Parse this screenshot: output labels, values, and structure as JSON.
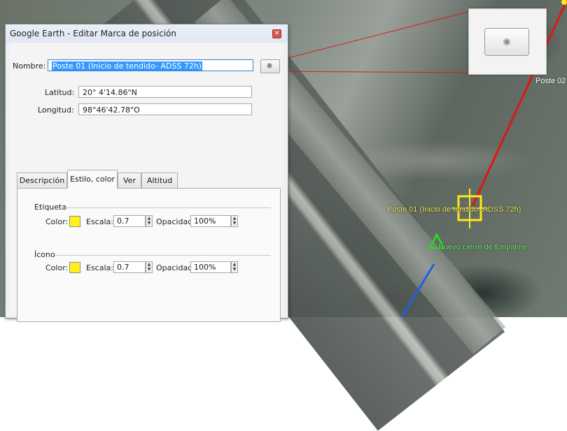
{
  "map": {
    "labels": {
      "pole2": "Poste 02",
      "pole1": "Poste 01  (Inicio de tendido- ADSS 72h)",
      "splice": "Nuevo cierre de Empalme"
    }
  },
  "dialog": {
    "title": "Google Earth - Editar Marca de posición",
    "close_icon": "close-icon",
    "name_label": "Nombre:",
    "name_value": "Poste 01  (Inicio de tendido- ADSS 72h)",
    "lat_label": "Latitud:",
    "lat_value": "20° 4'14.86\"N",
    "lon_label": "Longitud:",
    "lon_value": "98°46'42.78\"O",
    "tabs": [
      {
        "label": "Descripción",
        "active": false
      },
      {
        "label": "Estilo, color",
        "active": true
      },
      {
        "label": "Ver",
        "active": false
      },
      {
        "label": "Altitud",
        "active": false
      }
    ],
    "label_group": {
      "title": "Etiqueta",
      "color_label": "Color:",
      "color": "#fff21a",
      "scale_label": "Escala:",
      "scale_value": "0.7",
      "opacity_label": "Opacidad:",
      "opacity_value": "100%"
    },
    "icon_group": {
      "title": "Ícono",
      "color_label": "Color:",
      "color": "#fff21a",
      "scale_label": "Escala:",
      "scale_value": "0.7",
      "opacity_label": "Opacidad:",
      "opacity_value": "100%"
    }
  }
}
